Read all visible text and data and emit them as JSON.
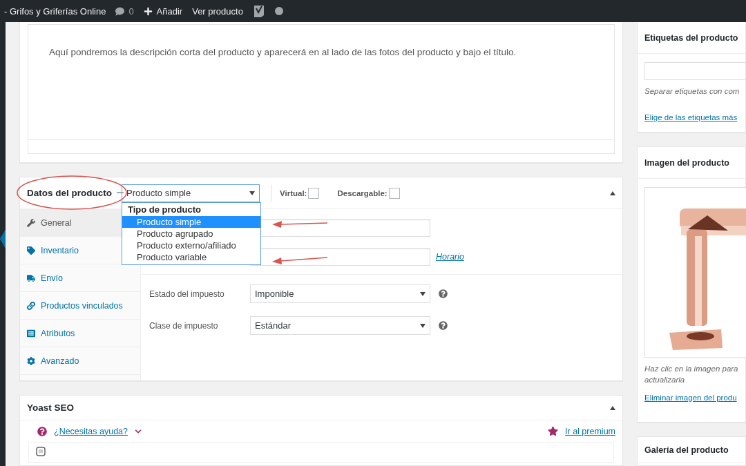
{
  "admin_bar": {
    "site": "- Grifos y Griferías Online",
    "comments": "0",
    "add": "Añadir",
    "view": "Ver producto"
  },
  "short_description": {
    "text": "Aquí pondremos la descripción corta del producto y aparecerá en al lado de las fotos del producto y bajo el título."
  },
  "product_data": {
    "title": "Datos del producto",
    "type_select": {
      "value": "Producto simple",
      "expanded": true,
      "group": "Tipo de producto",
      "options": [
        {
          "label": "Producto simple",
          "selected": true
        },
        {
          "label": "Producto agrupado",
          "selected": false
        },
        {
          "label": "Producto externo/afiliado",
          "selected": false
        },
        {
          "label": "Producto variable",
          "selected": false
        }
      ]
    },
    "virtual": {
      "label": "Virtual:",
      "checked": false
    },
    "downloadable": {
      "label": "Descargable:",
      "checked": false
    },
    "tabs": [
      {
        "label": "General",
        "selected": true
      },
      {
        "label": "Inventario",
        "selected": false
      },
      {
        "label": "Envío",
        "selected": false
      },
      {
        "label": "Productos vinculados",
        "selected": false
      },
      {
        "label": "Atributos",
        "selected": false
      },
      {
        "label": "Avanzado",
        "selected": false
      }
    ],
    "schedule_link": "Horario",
    "tax_fields": [
      {
        "label": "Estado del impuesto",
        "value": "Imponible"
      },
      {
        "label": "Clase de impuesto",
        "value": "Estándar"
      }
    ]
  },
  "yoast": {
    "title": "Yoast SEO",
    "help": "¿Necesitas ayuda?",
    "premium": "Ir al premium"
  },
  "sidebar": {
    "tags": {
      "title": "Etiquetas del producto",
      "hint": "Separar etiquetas con com",
      "link": "Elige de las etiquetas más"
    },
    "image": {
      "title": "Imagen del producto",
      "hint": "Haz clic en la imagen para",
      "hint2": "actualizarla",
      "link": "Eliminar imagen del produ"
    },
    "gallery": {
      "title": "Galería del producto"
    }
  }
}
